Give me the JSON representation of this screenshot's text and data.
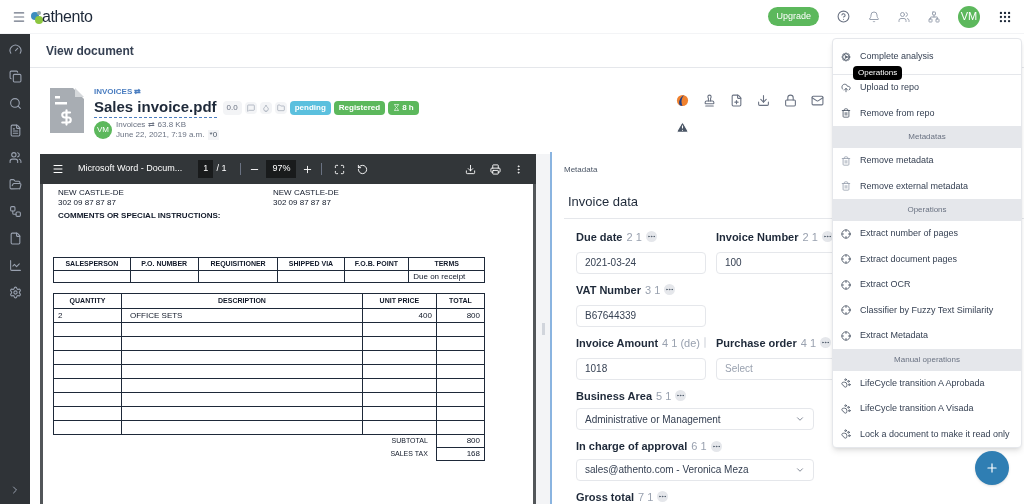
{
  "topbar": {
    "brand": "athento",
    "upgrade": "Upgrade",
    "avatar": "VM"
  },
  "page_title": "View document",
  "document": {
    "category": "INVOICES ⇄",
    "title": "Sales invoice.pdf",
    "version": "0.0",
    "badges": [
      {
        "label": "pending",
        "color": "#5bc0de"
      },
      {
        "label": "Registered",
        "color": "#5cb85c"
      },
      {
        "label": "8 h",
        "color": "#5cb85c"
      }
    ],
    "avatar": "VM",
    "type": "Invoices ⇄",
    "size": "63.8 KB",
    "date": "June 22, 2021, 7:19 a.m.",
    "tag": "*0"
  },
  "viewer": {
    "title": "Microsoft Word - Docum...",
    "page": "1",
    "pages": "/ 1",
    "zoom": "97%",
    "address_columns": [
      [
        "NEW CASTLE-DE",
        "302 09 87 87 87"
      ],
      [
        "NEW CASTLE-DE",
        "302 09 87 87 87"
      ]
    ],
    "comments": "COMMENTS OR SPECIAL INSTRUCTIONS:",
    "terms_table": {
      "columns": [
        "SALESPERSON",
        "P.O. NUMBER",
        "REQUISITIONER",
        "SHIPPED VIA",
        "F.O.B. POINT",
        "TERMS"
      ],
      "terms": "Due on receipt"
    },
    "items_table": {
      "columns": [
        "QUANTITY",
        "DESCRIPTION",
        "UNIT PRICE",
        "TOTAL"
      ],
      "rows": [
        [
          "2",
          "OFFICE SETS",
          "400",
          "800"
        ],
        [
          null,
          null,
          null,
          null
        ],
        [
          null,
          null,
          null,
          null
        ],
        [
          null,
          null,
          null,
          null
        ],
        [
          null,
          null,
          null,
          null
        ],
        [
          null,
          null,
          null,
          null
        ],
        [
          null,
          null,
          null,
          null
        ],
        [
          null,
          null,
          null,
          null
        ],
        [
          null,
          null,
          null,
          null
        ]
      ],
      "totals": [
        {
          "label": "SUBTOTAL",
          "value": "800"
        },
        {
          "label": "SALES TAX",
          "value": "168"
        }
      ]
    }
  },
  "metadata": {
    "tab": "Metadata",
    "section": "Invoice data",
    "rows": [
      [
        {
          "label": "Due date",
          "counter": "2 1",
          "kind": "text",
          "value": "2021-03-24"
        },
        {
          "label": "Invoice Number",
          "counter": "2 1",
          "kind": "text",
          "value": "100"
        }
      ],
      [
        {
          "label": "VAT Number",
          "counter": "3 1",
          "kind": "text",
          "value": "B67644339"
        }
      ],
      [
        {
          "label": "Invoice Amount",
          "counter": "4 1 (de)",
          "kind": "text",
          "value": "1018"
        },
        {
          "label": "Purchase order",
          "counter": "4 1",
          "kind": "text",
          "placeholder": "Select"
        }
      ],
      [
        {
          "label": "Business Area",
          "counter": "5 1",
          "kind": "select",
          "value": "Administrative or Management"
        }
      ],
      [
        {
          "label": "In charge of approval",
          "counter": "6 1",
          "kind": "select",
          "value": "sales@athento.com - Veronica Meza"
        }
      ],
      [
        {
          "label": "Gross total",
          "counter": "7 1",
          "kind": "text"
        }
      ]
    ]
  },
  "menu": [
    {
      "kind": "analysis",
      "label": "Complete analysis"
    },
    {
      "kind": "upload",
      "label": "Upload to repo"
    },
    {
      "kind": "remove",
      "label": "Remove from repo"
    },
    {
      "kind": "header",
      "label": "Metadatas"
    },
    {
      "kind": "clear",
      "label": "Remove metadata"
    },
    {
      "kind": "clear",
      "label": "Remove external metadata"
    },
    {
      "kind": "header",
      "label": "Operations"
    },
    {
      "kind": "extract",
      "label": "Extract number of pages"
    },
    {
      "kind": "extract",
      "label": "Extract document pages"
    },
    {
      "kind": "extract",
      "label": "Extract OCR"
    },
    {
      "kind": "extract",
      "label": "Classifier by Fuzzy Text Similarity"
    },
    {
      "kind": "extract",
      "label": "Extract Metadata"
    },
    {
      "kind": "header",
      "label": "Manual operations"
    },
    {
      "kind": "manual",
      "label": "LifeCycle transition A Aprobada"
    },
    {
      "kind": "manual",
      "label": "LifeCycle transition A Visada"
    },
    {
      "kind": "manual",
      "label": "Lock a document to make it read only"
    }
  ],
  "tooltip": "Operations"
}
